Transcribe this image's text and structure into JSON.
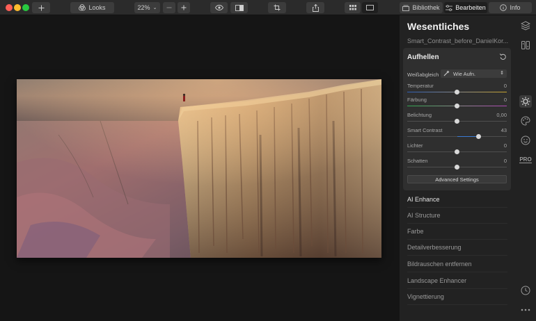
{
  "toolbar": {
    "looks_label": "Looks",
    "zoom_value": "22%",
    "bibliothek_label": "Bibliothek",
    "bearbeiten_label": "Bearbeiten",
    "info_label": "Info"
  },
  "panel": {
    "title": "Wesentliches",
    "filename": "Smart_Contrast_before_DanielKor...",
    "card": {
      "title": "Aufhellen",
      "white_balance_label": "Weißabgleich",
      "white_balance_value": "Wie Aufn.",
      "sliders": [
        {
          "label": "Temperatur",
          "value": "0",
          "level": 0.5
        },
        {
          "label": "Färbung",
          "value": "0",
          "level": 0.5
        },
        {
          "label": "Belichtung",
          "value": "0,00",
          "level": 0.5
        },
        {
          "label": "Smart Contrast",
          "value": "43",
          "level": 0.715
        },
        {
          "label": "Lichter",
          "value": "0",
          "level": 0.5
        },
        {
          "label": "Schatten",
          "value": "0",
          "level": 0.5
        }
      ],
      "advanced_label": "Advanced Settings"
    },
    "tools": [
      "AI Enhance",
      "AI Structure",
      "Farbe",
      "Detailverbesserung",
      "Bildrauschen entfernen",
      "Landscape Enhancer",
      "Vignettierung"
    ]
  },
  "side_icons": [
    "layers-icon",
    "presets-icon",
    "sun-icon",
    "palette-icon",
    "face-icon",
    "pro-badge",
    "history-icon",
    "more-icon"
  ],
  "side_pro_label": "PRO",
  "colors": {
    "accent": "#3b7bd4",
    "background": "#151515",
    "panel": "#222222",
    "card": "#2f2f2f"
  }
}
